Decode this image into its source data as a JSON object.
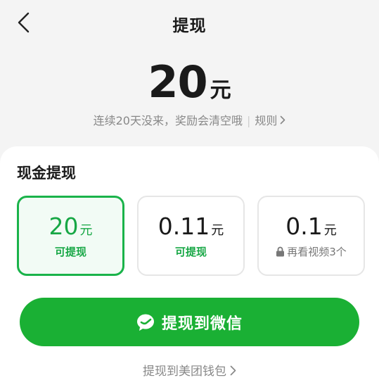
{
  "header": {
    "title": "提现"
  },
  "balance": {
    "amount": "20",
    "unit": "元"
  },
  "notice": {
    "text": "连续20天没来，奖励会清空哦",
    "rules_label": "规则"
  },
  "cash": {
    "title": "现金提现",
    "options": [
      {
        "amount": "20",
        "unit": "元",
        "status": "可提现",
        "selected": true
      },
      {
        "amount": "0.11",
        "unit": "元",
        "status": "可提现",
        "selected": false
      },
      {
        "amount": "0.1",
        "unit": "元",
        "status": "再看视频3个",
        "locked": true,
        "selected": false
      }
    ]
  },
  "actions": {
    "wechat_label": "提现到微信",
    "meituan_label": "提现到美团钱包"
  },
  "icons": {
    "back": "chevron-left-icon",
    "wechat": "wechat-icon",
    "lock": "lock-icon",
    "chevron": "chevron-right-icon"
  },
  "colors": {
    "accent": "#1ab034",
    "accent_text": "#17a745",
    "selected_bg": "#f2fbf5",
    "page_bg": "#f4f4f4"
  }
}
